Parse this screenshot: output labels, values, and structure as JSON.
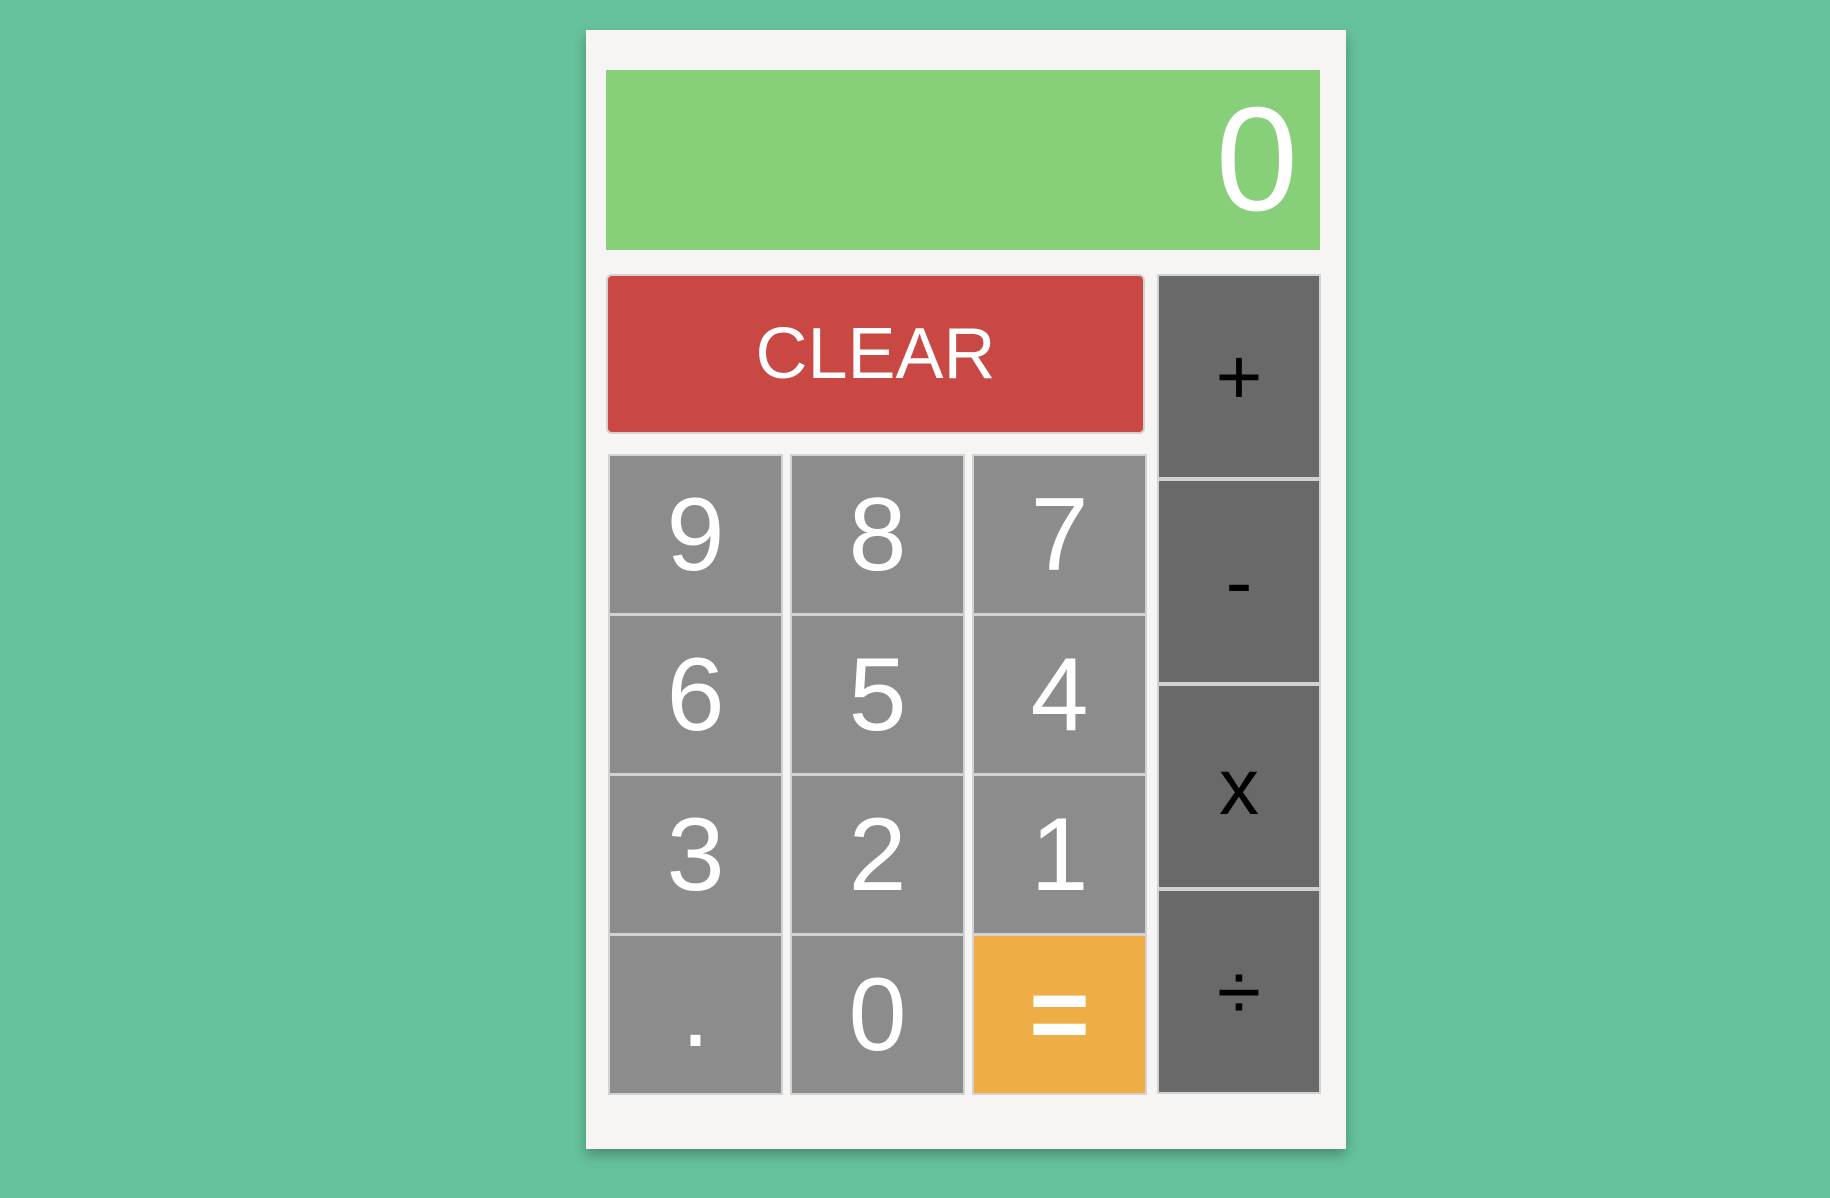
{
  "display": {
    "value": "0"
  },
  "buttons": {
    "clear": "CLEAR",
    "nine": "9",
    "eight": "8",
    "seven": "7",
    "six": "6",
    "five": "5",
    "four": "4",
    "three": "3",
    "two": "2",
    "one": "1",
    "decimal": ".",
    "zero": "0",
    "equals": "=",
    "add": "+",
    "subtract": "-",
    "multiply": "x",
    "divide": "÷"
  },
  "colors": {
    "background": "#66c29c",
    "display": "#88cf7a",
    "clear": "#c94843",
    "number_key": "#8c8c8c",
    "equals_key": "#efae45",
    "operator_key": "#696969"
  }
}
